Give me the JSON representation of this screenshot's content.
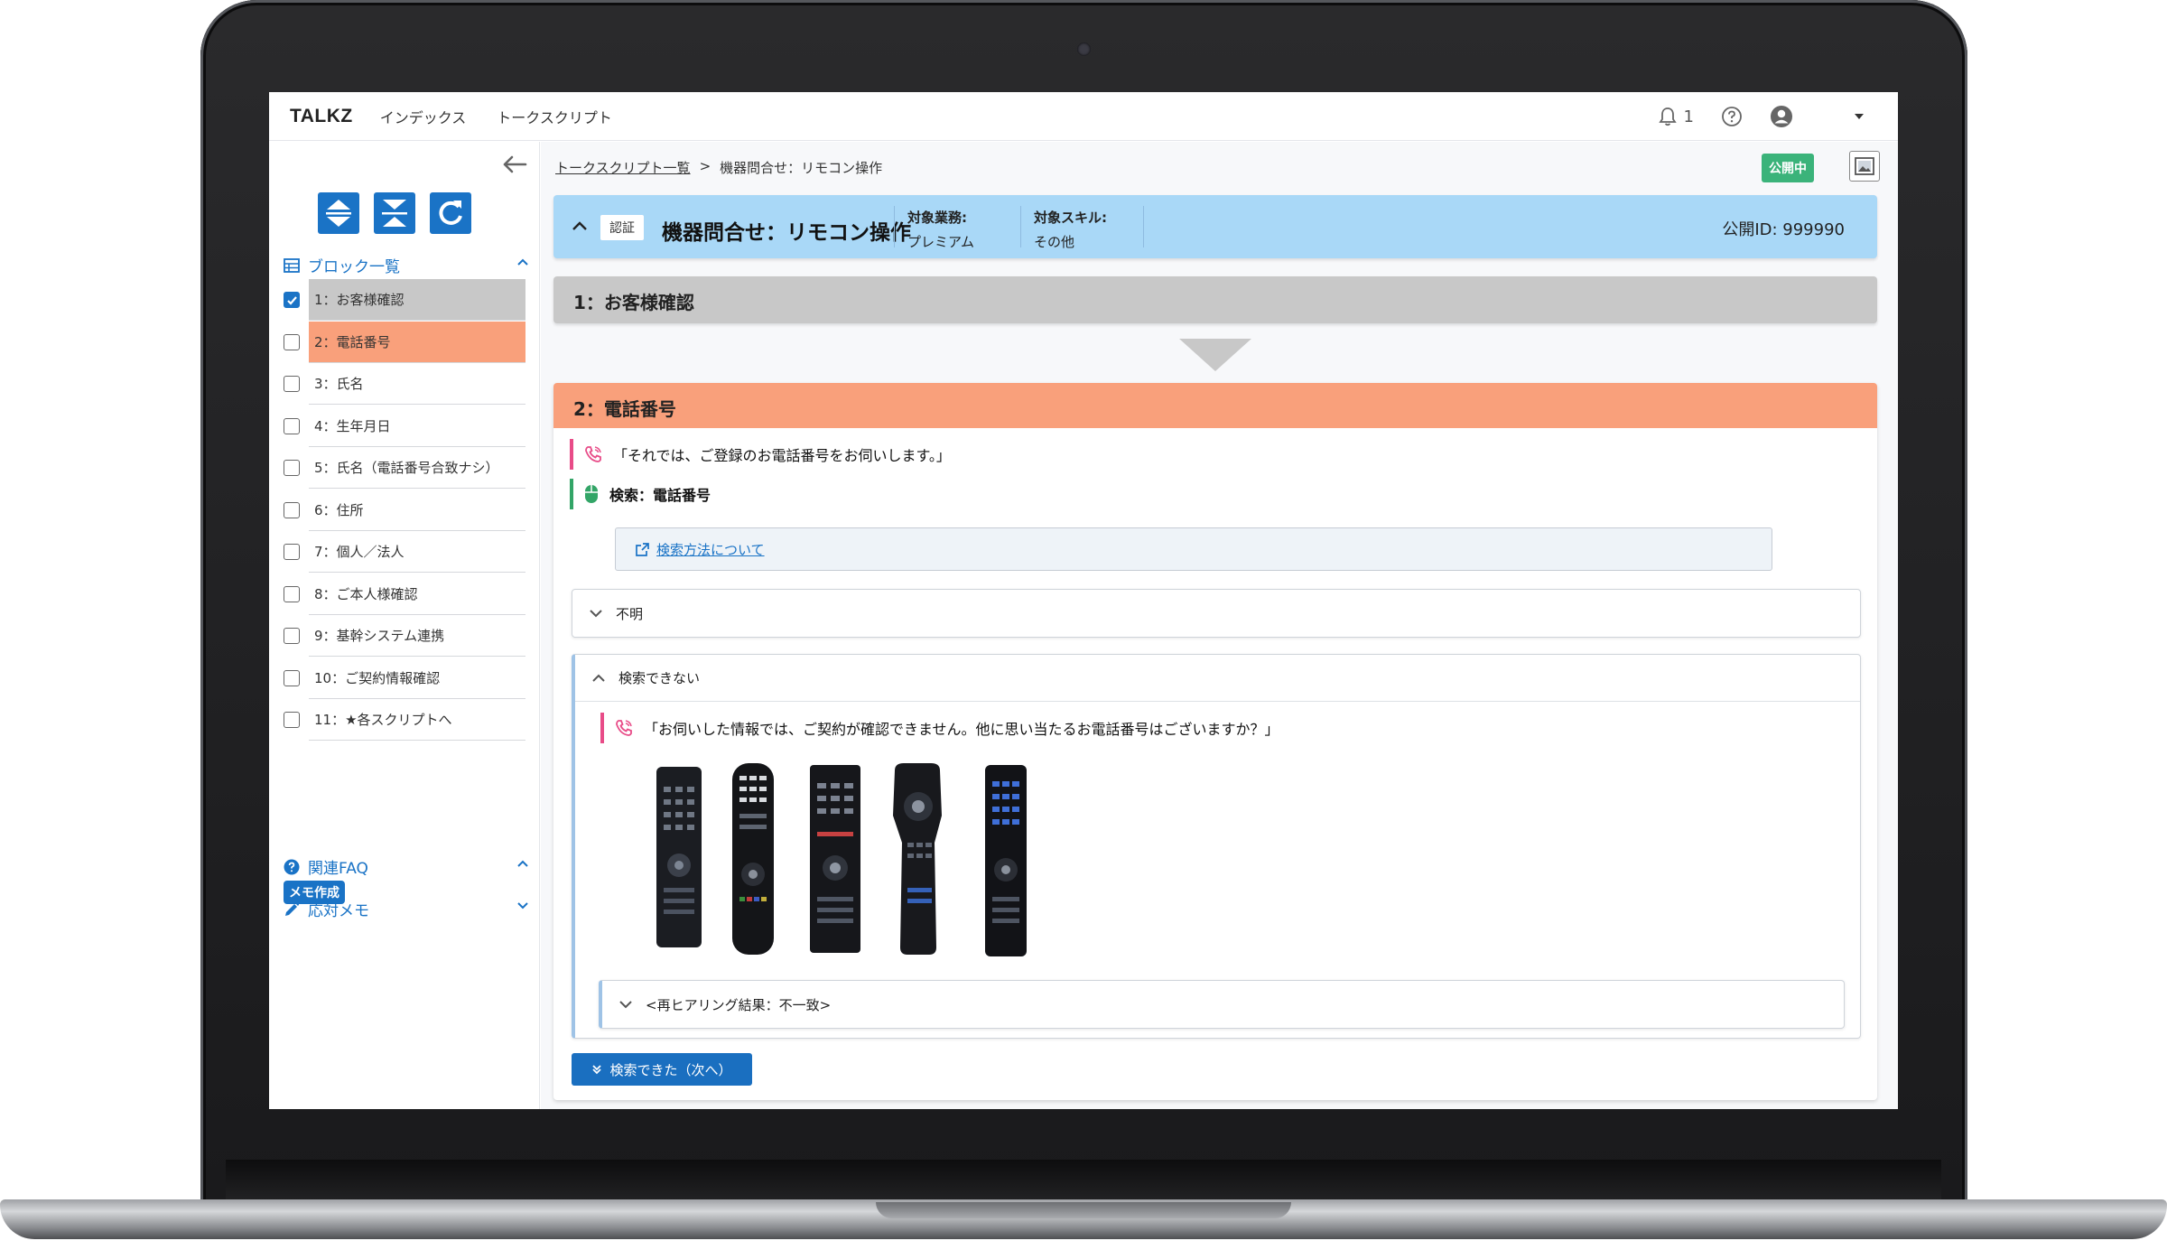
{
  "app": {
    "brand": "TALKZ",
    "nav": [
      "インデックス",
      "トークスクリプト"
    ],
    "notification_count": "1"
  },
  "sidebar": {
    "block_list_title": "ブロック一覧",
    "blocks": [
      {
        "label": "1：お客様確認",
        "state": "done",
        "checked": true
      },
      {
        "label": "2：電話番号",
        "state": "active",
        "checked": false
      },
      {
        "label": "3：氏名",
        "state": "none",
        "checked": false
      },
      {
        "label": "4：生年月日",
        "state": "none",
        "checked": false
      },
      {
        "label": "5：氏名（電話番号合致ナシ）",
        "state": "none",
        "checked": false
      },
      {
        "label": "6：住所",
        "state": "none",
        "checked": false
      },
      {
        "label": "7：個人／法人",
        "state": "none",
        "checked": false
      },
      {
        "label": "8：ご本人様確認",
        "state": "none",
        "checked": false
      },
      {
        "label": "9：基幹システム連携",
        "state": "none",
        "checked": false
      },
      {
        "label": "10：ご契約情報確認",
        "state": "none",
        "checked": false
      },
      {
        "label": "11：★各スクリプトへ",
        "state": "none",
        "checked": false
      }
    ],
    "faq_title": "関連FAQ",
    "memo_title": "応対メモ",
    "memo_button": "メモ作成"
  },
  "main": {
    "breadcrumb": {
      "root": "トークスクリプト一覧",
      "separator": ">",
      "current": "機器問合せ：リモコン操作"
    },
    "status_badge": "公開中",
    "header": {
      "tag": "認証",
      "title": "機器問合せ：リモコン操作",
      "meta": [
        {
          "key": "対象業務:",
          "value": "プレミアム"
        },
        {
          "key": "対象スキル:",
          "value": "その他"
        }
      ],
      "public_id": "公開ID: 999990"
    },
    "block1_title": "1：お客様確認",
    "block2": {
      "title": "2：電話番号",
      "talk": "「それでは、ご登録のお電話番号をお伺いします。」",
      "action": "検索：電話番号",
      "howto_link": "検索方法について",
      "branches": [
        {
          "label": "不明",
          "expanded": false
        },
        {
          "label": "検索できない",
          "expanded": true,
          "talk": "「お伺いした情報では、ご契約が確認できません。他に思い当たるお電話番号はございますか？」",
          "sub": "<再ヒアリング結果：不一致>"
        }
      ],
      "next_button": "検索できた（次へ）"
    }
  },
  "colors": {
    "accent": "#1a73c6",
    "header_bg": "#a9d8f7",
    "done_bg": "#c8c8c8",
    "active_bg": "#f9a07b",
    "published": "#3bb37a",
    "talk_marker": "#e84c88",
    "action_marker": "#33a567"
  }
}
